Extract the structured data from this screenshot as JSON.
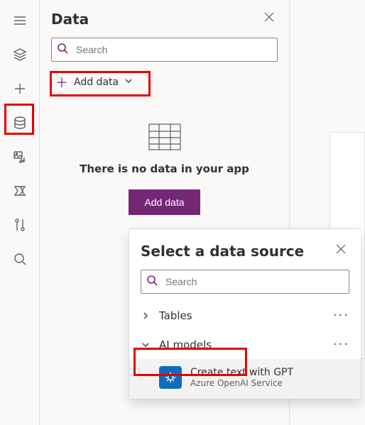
{
  "panel": {
    "title": "Data",
    "search_placeholder": "Search",
    "add_data_label": "Add data"
  },
  "empty": {
    "message": "There is no data in your app",
    "button": "Add data"
  },
  "flyout": {
    "title": "Select a data source",
    "search_placeholder": "Search",
    "tables_label": "Tables",
    "ai_models_label": "AI models",
    "model": {
      "title": "Create text with GPT",
      "subtitle": "Azure OpenAI Service"
    }
  },
  "colors": {
    "accent": "#742774",
    "highlight": "#e60000",
    "azure_badge": "#0f6cbd"
  }
}
